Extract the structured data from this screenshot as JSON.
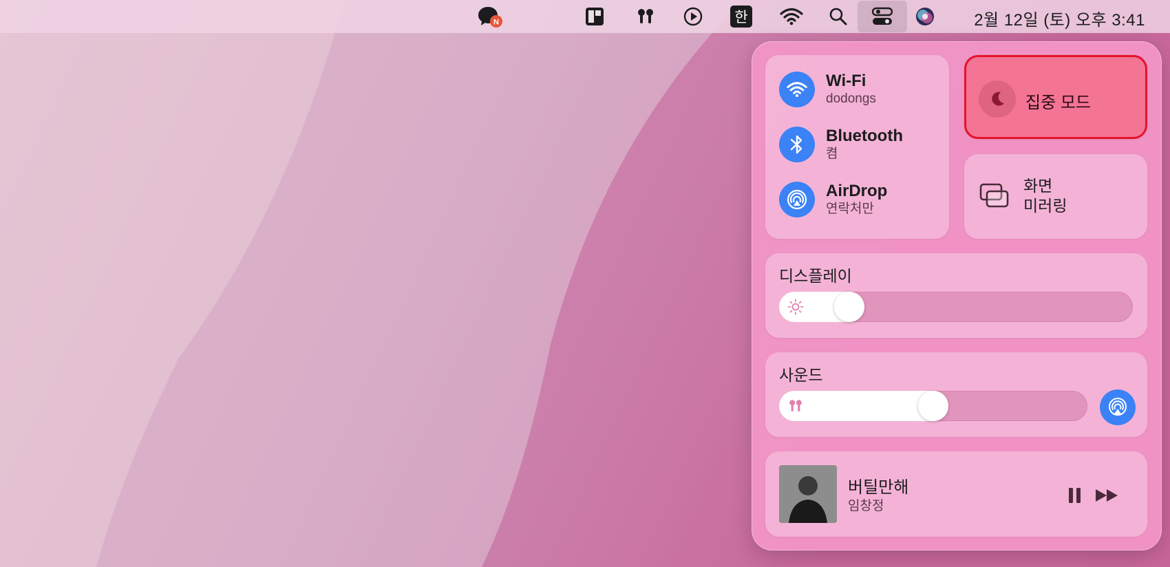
{
  "menubar": {
    "input_method": "한",
    "clock": "2월 12일 (토) 오후  3:41"
  },
  "control_center": {
    "wifi": {
      "title": "Wi-Fi",
      "subtitle": "dodongs"
    },
    "bluetooth": {
      "title": "Bluetooth",
      "subtitle": "켬"
    },
    "airdrop": {
      "title": "AirDrop",
      "subtitle": "연락처만"
    },
    "focus": {
      "label": "집중 모드"
    },
    "mirroring": {
      "line1": "화면",
      "line2": "미러링"
    },
    "display": {
      "title": "디스플레이",
      "level": 0.17
    },
    "sound": {
      "title": "사운드",
      "level": 0.5
    },
    "now_playing": {
      "title": "버틸만해",
      "artist": "임창정"
    }
  },
  "colors": {
    "accent_blue": "#3b82f6",
    "focus_highlight_border": "#e3142a",
    "panel": "#f396c8"
  },
  "icons": {
    "menubar": [
      "messenger-icon",
      "layout-icon",
      "airpods-icon",
      "play-icon",
      "input-method-icon",
      "wifi-icon",
      "search-icon",
      "control-center-icon",
      "siri-icon"
    ],
    "panel": [
      "wifi-icon",
      "bluetooth-icon",
      "airdrop-icon",
      "moon-icon",
      "screen-mirroring-icon",
      "sun-icon",
      "airpods-icon",
      "airplay-icon",
      "pause-icon",
      "forward-icon"
    ]
  }
}
